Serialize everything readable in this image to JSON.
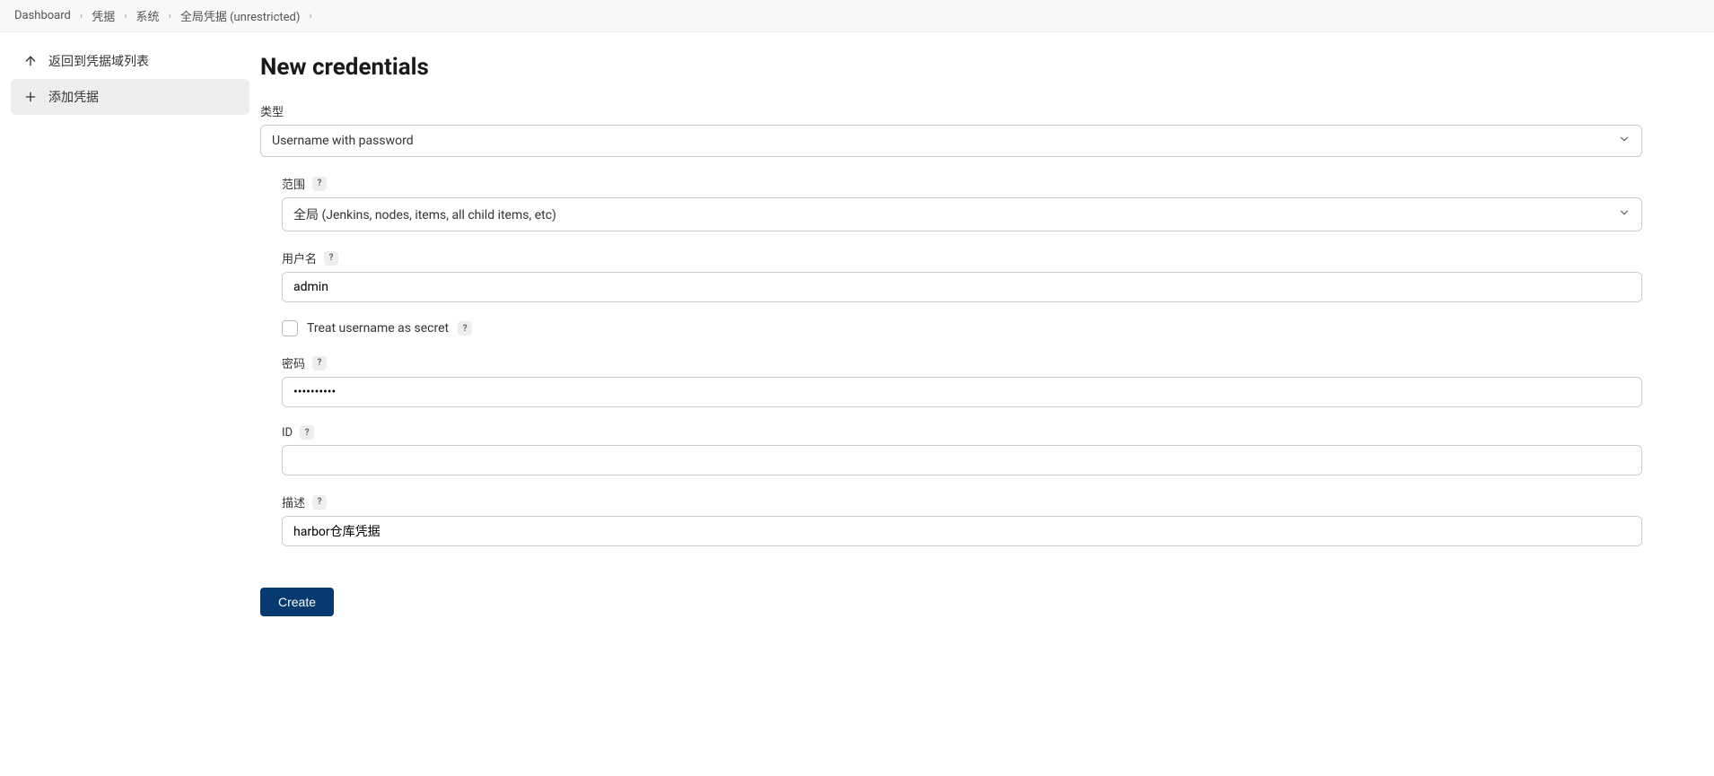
{
  "breadcrumb": [
    {
      "label": "Dashboard"
    },
    {
      "label": "凭据"
    },
    {
      "label": "系统"
    },
    {
      "label": "全局凭据 (unrestricted)"
    }
  ],
  "sidebar": {
    "back": {
      "label": "返回到凭据域列表"
    },
    "add": {
      "label": "添加凭据"
    }
  },
  "page": {
    "title": "New credentials"
  },
  "form": {
    "type": {
      "label": "类型",
      "value": "Username with password"
    },
    "scope": {
      "label": "范围",
      "value": "全局 (Jenkins, nodes, items, all child items, etc)"
    },
    "username": {
      "label": "用户名",
      "value": "admin"
    },
    "treat_secret": {
      "label": "Treat username as secret",
      "checked": false
    },
    "password": {
      "label": "密码",
      "value": "••••••••••"
    },
    "id": {
      "label": "ID",
      "value": ""
    },
    "description": {
      "label": "描述",
      "value": "harbor仓库凭据"
    }
  },
  "actions": {
    "create": "Create"
  },
  "help_char": "?"
}
